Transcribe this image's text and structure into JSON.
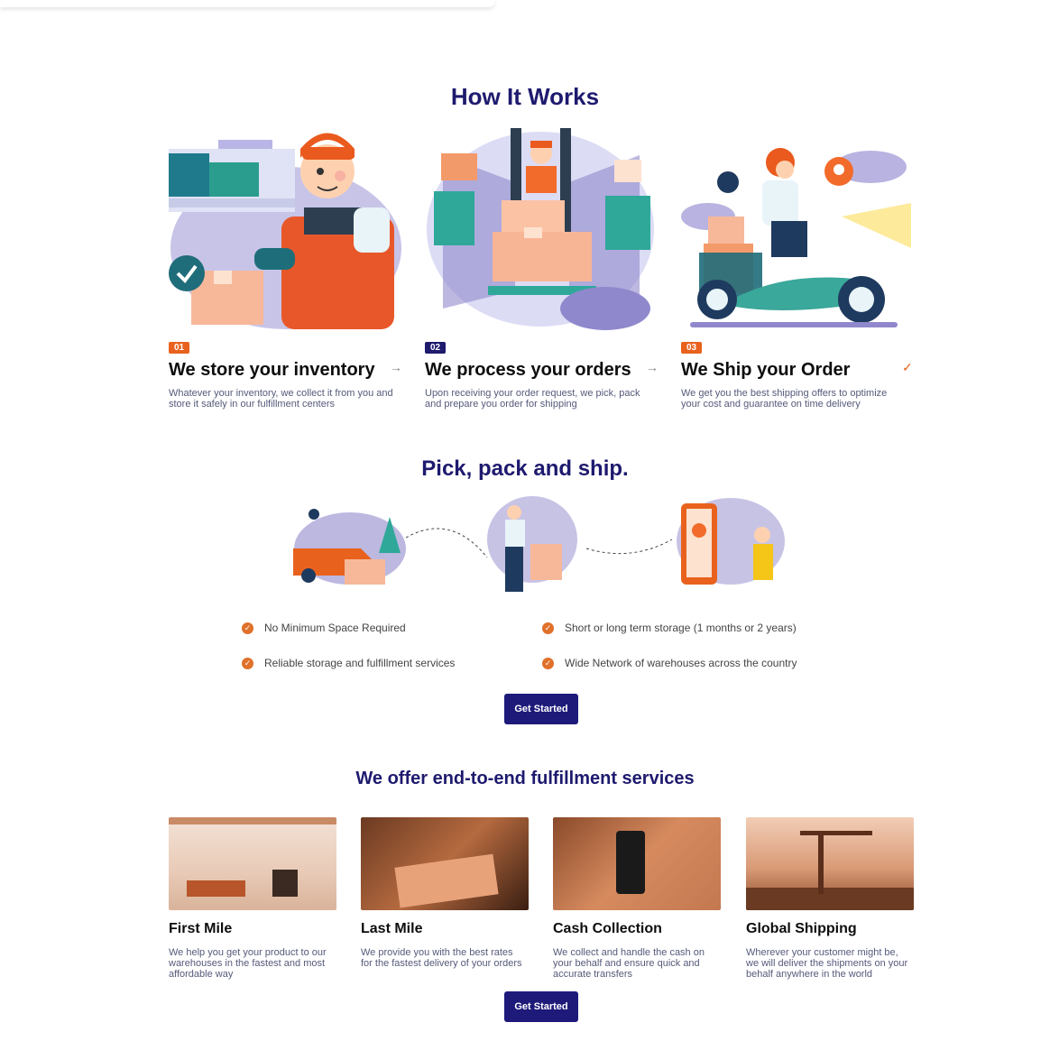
{
  "how_it_works": {
    "heading": "How It Works",
    "steps": [
      {
        "number": "01",
        "title": "We store your inventory",
        "description": "Whatever your inventory, we collect it from you and store it safely in our fulfillment centers",
        "indicator": "→"
      },
      {
        "number": "02",
        "title": "We process your orders",
        "description": "Upon receiving your order request, we pick, pack and prepare you order for shipping",
        "indicator": "→"
      },
      {
        "number": "03",
        "title": "We Ship your Order",
        "description": "We get you the best shipping offers to optimize your cost and guarantee on time delivery",
        "indicator": "✓"
      }
    ]
  },
  "pick_pack_ship": {
    "heading": "Pick, pack and ship.",
    "features": [
      "No Minimum Space Required",
      "Short or long term storage (1 months or 2 years)",
      "Reliable storage and fulfillment services",
      "Wide Network of warehouses across the country"
    ],
    "cta_label": "Get Started"
  },
  "services": {
    "heading": "We offer end-to-end fulfillment services",
    "items": [
      {
        "title": "First Mile",
        "description": "We help you get your product to our warehouses in the fastest and most affordable way"
      },
      {
        "title": "Last Mile",
        "description": "We provide you with the best rates for the fastest delivery of your orders"
      },
      {
        "title": "Cash Collection",
        "description": "We collect and handle the cash on your behalf and ensure quick and accurate transfers"
      },
      {
        "title": "Global Shipping",
        "description": "Wherever your customer might be, we will deliver the shipments on your behalf anywhere in the world"
      }
    ],
    "cta_label": "Get Started"
  },
  "colors": {
    "navy": "#1e1a6e",
    "orange": "#e8621e",
    "teal": "#2fa89a",
    "lavender": "#8f88cc"
  },
  "icons": [
    "check-circle-icon",
    "arrow-right-icon",
    "checkmark-icon",
    "location-pin-icon"
  ]
}
